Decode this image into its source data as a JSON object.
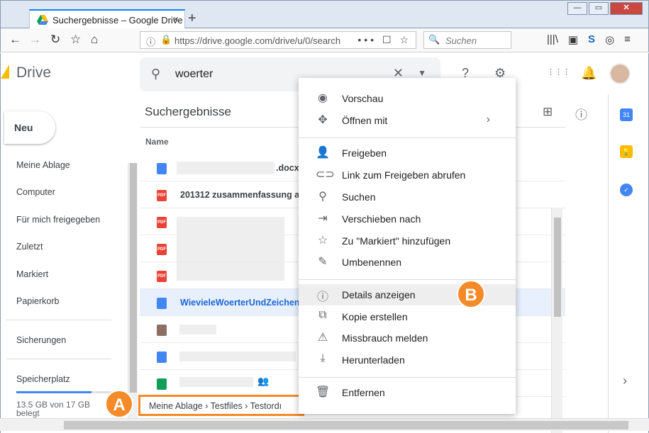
{
  "browser": {
    "tab_title": "Suchergebnisse – Google Drive",
    "tab_close": "×",
    "new_tab": "+",
    "url": "https://drive.google.com/drive/u/0/search",
    "url_actions": "••• ☐ ☆",
    "search_placeholder": "Suchen",
    "window_buttons": {
      "minimize": "—",
      "maximize": "▭",
      "close": "✕"
    },
    "nav": {
      "back": "←",
      "forward": "→",
      "reload": "↻",
      "home": "⌂"
    },
    "right_icons": [
      "|||\\",
      "▣",
      "S",
      "◎",
      "≡"
    ]
  },
  "drive": {
    "logo_text": "Drive",
    "search_query": "woerter",
    "clear_icon": "✕",
    "dropdown_icon": "▼",
    "top_icons": {
      "help": "?",
      "settings": "⚙",
      "apps": "⋮⋮⋮",
      "notifications": "🔔"
    }
  },
  "sidebar": {
    "new_button": "Neu",
    "items": [
      "Meine Ablage",
      "Computer",
      "Für mich freigegeben",
      "Zuletzt",
      "Markiert",
      "Papierkorb"
    ],
    "backups": "Sicherungen",
    "storage_label": "Speicherplatz",
    "storage_text": "13.5 GB von 17 GB belegt",
    "storage_used_fraction": 0.79
  },
  "main": {
    "title": "Suchergebnisse",
    "column_name": "Name",
    "view_icons": {
      "grid": "⊞",
      "info": "ⓘ"
    },
    "files": [
      {
        "type": "doc",
        "name": ".docx",
        "selected": false
      },
      {
        "type": "pdf",
        "name": "201312 zusammenfassung an",
        "selected": false
      },
      {
        "type": "pdf",
        "name": "",
        "selected": false
      },
      {
        "type": "pdf",
        "name": "",
        "selected": false
      },
      {
        "type": "pdf",
        "name": "",
        "selected": false
      },
      {
        "type": "doc",
        "name": "WievieleWoerterUndZeichen",
        "selected": true
      },
      {
        "type": "img",
        "name": "",
        "selected": false
      },
      {
        "type": "doc",
        "name": "",
        "selected": false
      },
      {
        "type": "sheet",
        "name": "",
        "selected": false
      }
    ],
    "breadcrumb": "Meine Ablage  ›  Testfiles  ›  Testordı"
  },
  "menu": {
    "groups": [
      [
        {
          "icon": "◉",
          "label": "Vorschau"
        },
        {
          "icon": "✥",
          "label": "Öffnen mit",
          "submenu": "›"
        }
      ],
      [
        {
          "icon": "👤",
          "label": "Freigeben"
        },
        {
          "icon": "⊂⊃",
          "label": "Link zum Freigeben abrufen"
        },
        {
          "icon": "⚲",
          "label": "Suchen"
        },
        {
          "icon": "⇥",
          "label": "Verschieben nach"
        },
        {
          "icon": "☆",
          "label": "Zu \"Markiert\" hinzufügen"
        },
        {
          "icon": "✎",
          "label": "Umbenennen"
        }
      ],
      [
        {
          "icon": "ⓘ",
          "label": "Details anzeigen",
          "highlighted": true
        },
        {
          "icon": "⧉",
          "label": "Kopie erstellen"
        },
        {
          "icon": "⚠",
          "label": "Missbrauch melden"
        },
        {
          "icon": "⤓",
          "label": "Herunterladen"
        }
      ],
      [
        {
          "icon": "🗑",
          "label": "Entfernen"
        }
      ]
    ]
  },
  "annotations": {
    "a": "A",
    "b": "B"
  },
  "side_panel": {
    "calendar": "31",
    "keep": "💡",
    "tasks": "✓",
    "expand": "›"
  },
  "colors": {
    "accent": "#f58a29",
    "drive_blue": "#4285f4",
    "pdf_red": "#ea4335",
    "sheet_green": "#0f9d58"
  }
}
